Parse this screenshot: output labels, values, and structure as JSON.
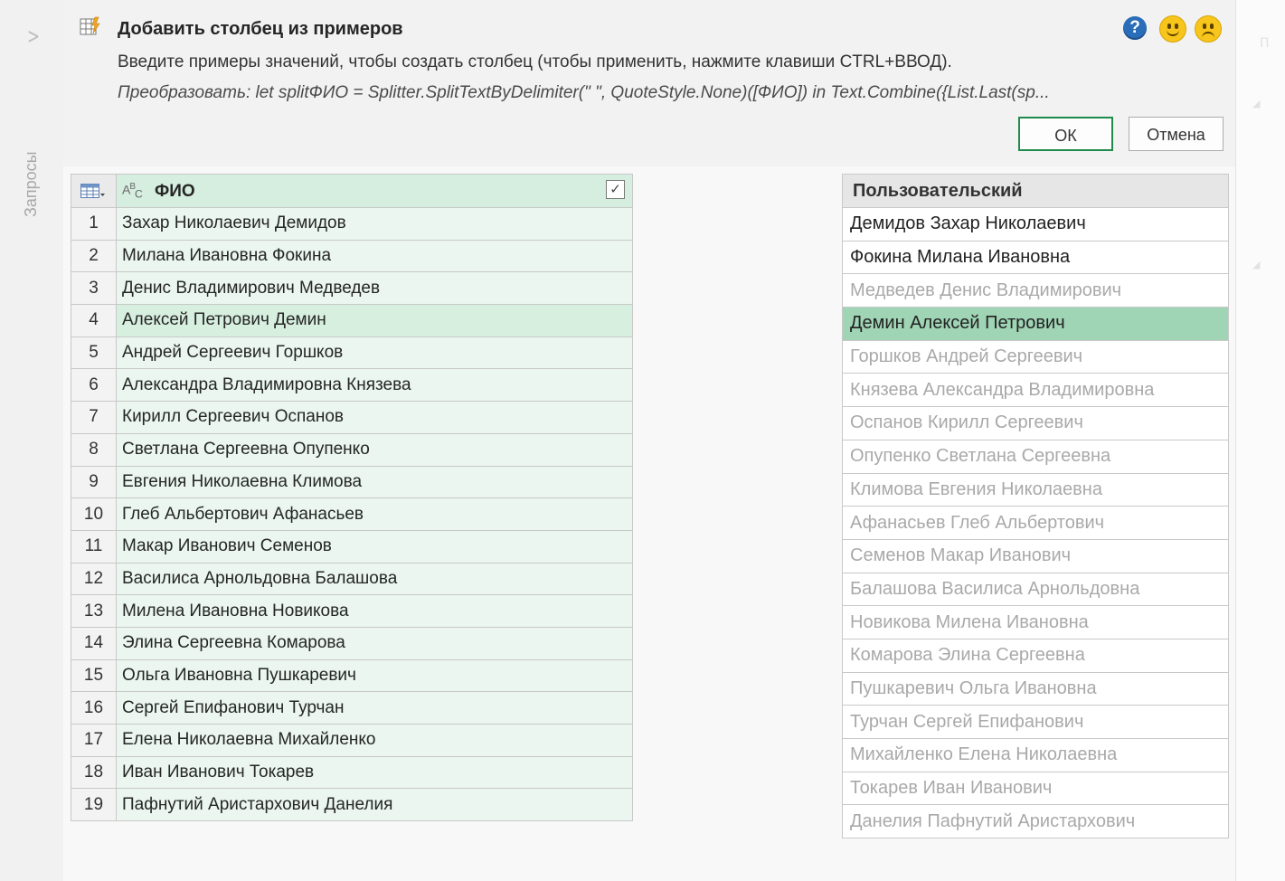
{
  "sidebar": {
    "label": "Запросы",
    "expand_icon": "chevron-right-icon"
  },
  "dialog": {
    "title": "Добавить столбец из примеров",
    "description": "Введите примеры значений, чтобы создать столбец (чтобы применить, нажмите клавиши CTRL+ВВОД).",
    "formula": "Преобразовать: let splitФИО = Splitter.SplitTextByDelimiter(\" \", QuoteStyle.None)([ФИО]) in Text.Combine({List.Last(sp...",
    "ok_label": "ОК",
    "cancel_label": "Отмена",
    "help_label": "?"
  },
  "source_table": {
    "header": "ФИО",
    "type_icon": "abc-text-type-icon",
    "selected_row": 4,
    "rows": [
      {
        "index": "1",
        "value": "Захар Николаевич Демидов"
      },
      {
        "index": "2",
        "value": "Милана Ивановна Фокина"
      },
      {
        "index": "3",
        "value": "Денис Владимирович Медведев"
      },
      {
        "index": "4",
        "value": "Алексей Петрович Демин"
      },
      {
        "index": "5",
        "value": "Андрей Сергеевич Горшков"
      },
      {
        "index": "6",
        "value": "Александра Владимировна Князева"
      },
      {
        "index": "7",
        "value": "Кирилл Сергеевич Оспанов"
      },
      {
        "index": "8",
        "value": "Светлана Сергеевна Опупенко"
      },
      {
        "index": "9",
        "value": "Евгения Николаевна Климова"
      },
      {
        "index": "10",
        "value": "Глеб Альбертович Афанасьев"
      },
      {
        "index": "11",
        "value": "Макар Иванович Семенов"
      },
      {
        "index": "12",
        "value": "Василиса Арнольдовна Балашова"
      },
      {
        "index": "13",
        "value": "Милена Ивановна Новикова"
      },
      {
        "index": "14",
        "value": "Элина Сергеевна Комарова"
      },
      {
        "index": "15",
        "value": "Ольга Ивановна Пушкаревич"
      },
      {
        "index": "16",
        "value": "Сергей Епифанович Турчан"
      },
      {
        "index": "17",
        "value": "Елена Николаевна Михайленко"
      },
      {
        "index": "18",
        "value": "Иван Иванович Токарев"
      },
      {
        "index": "19",
        "value": "Пафнутий Аристархович Данелия"
      }
    ]
  },
  "custom_table": {
    "header": "Пользовательский",
    "rows": [
      {
        "value": "Демидов Захар Николаевич",
        "state": "entered"
      },
      {
        "value": "Фокина Милана Ивановна",
        "state": "entered"
      },
      {
        "value": "Медведев Денис Владимирович",
        "state": "suggested"
      },
      {
        "value": "Демин Алексей Петрович",
        "state": "selected"
      },
      {
        "value": "Горшков Андрей Сергеевич",
        "state": "suggested"
      },
      {
        "value": "Князева Александра Владимировна",
        "state": "suggested"
      },
      {
        "value": "Оспанов Кирилл Сергеевич",
        "state": "suggested"
      },
      {
        "value": "Опупенко Светлана Сергеевна",
        "state": "suggested"
      },
      {
        "value": "Климова Евгения Николаевна",
        "state": "suggested"
      },
      {
        "value": "Афанасьев Глеб Альбертович",
        "state": "suggested"
      },
      {
        "value": "Семенов Макар Иванович",
        "state": "suggested"
      },
      {
        "value": "Балашова Василиса Арнольдовна",
        "state": "suggested"
      },
      {
        "value": "Новикова Милена Ивановна",
        "state": "suggested"
      },
      {
        "value": "Комарова Элина Сергеевна",
        "state": "suggested"
      },
      {
        "value": "Пушкаревич Ольга Ивановна",
        "state": "suggested"
      },
      {
        "value": "Турчан Сергей Епифанович",
        "state": "suggested"
      },
      {
        "value": "Михайленко Елена Николаевна",
        "state": "suggested"
      },
      {
        "value": "Токарев Иван Иванович",
        "state": "suggested"
      },
      {
        "value": "Данелия Пафнутий Аристархович",
        "state": "suggested"
      }
    ]
  },
  "colors": {
    "accent_green": "#1f8a4c",
    "selected_row": "#9fd4b5",
    "source_column": "#eaf6ef",
    "suggestion_text": "#a9a9a9"
  }
}
